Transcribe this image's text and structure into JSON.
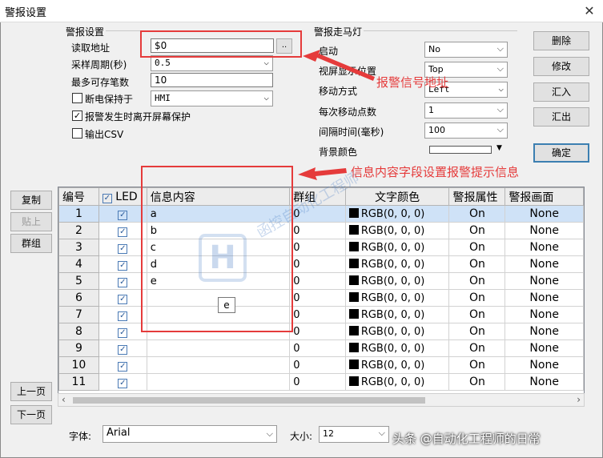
{
  "window": {
    "title": "警报设置",
    "close": "✕"
  },
  "alarm_settings": {
    "group_label": "警报设置",
    "read_address_label": "读取地址",
    "read_address_value": "$0",
    "browse_label": "..",
    "sample_period_label": "采样周期(秒)",
    "sample_period_value": "0.5",
    "max_records_label": "最多可存笔数",
    "max_records_value": "10",
    "power_loss_label": "断电保持于",
    "power_loss_value": "HMI",
    "protect_label": "报警发生时离开屏幕保护",
    "protect_checked": true,
    "csv_label": "输出CSV",
    "csv_checked": false
  },
  "marquee": {
    "group_label": "警报走马灯",
    "enable_label": "启动",
    "enable_value": "No",
    "position_label": "视屏显示位置",
    "position_value": "Top",
    "move_label": "移动方式",
    "move_value": "Left",
    "points_label": "每次移动点数",
    "points_value": "1",
    "interval_label": "间隔时间(毫秒)",
    "interval_value": "100",
    "bg_label": "背景颜色"
  },
  "buttons": {
    "delete": "删除",
    "modify": "修改",
    "import": "汇入",
    "export": "汇出",
    "ok": "确定",
    "copy": "复制",
    "paste": "贴上",
    "group": "群组",
    "prev_page": "上一页",
    "next_page": "下一页"
  },
  "annotations": {
    "address": "报警信号地址",
    "content": "信息内容字段设置报警提示信息"
  },
  "tooltip": "e",
  "table": {
    "headers": {
      "num": "编号",
      "led": "LED",
      "content": "信息内容",
      "group": "群组",
      "color": "文字颜色",
      "attr": "警报属性",
      "screen": "警报画面"
    },
    "rows": [
      {
        "num": "1",
        "content": "a",
        "group": "0",
        "color": "RGB(0, 0, 0)",
        "attr": "On",
        "screen": "None"
      },
      {
        "num": "2",
        "content": "b",
        "group": "0",
        "color": "RGB(0, 0, 0)",
        "attr": "On",
        "screen": "None"
      },
      {
        "num": "3",
        "content": "c",
        "group": "0",
        "color": "RGB(0, 0, 0)",
        "attr": "On",
        "screen": "None"
      },
      {
        "num": "4",
        "content": "d",
        "group": "0",
        "color": "RGB(0, 0, 0)",
        "attr": "On",
        "screen": "None"
      },
      {
        "num": "5",
        "content": "e",
        "group": "0",
        "color": "RGB(0, 0, 0)",
        "attr": "On",
        "screen": "None"
      },
      {
        "num": "6",
        "content": "",
        "group": "0",
        "color": "RGB(0, 0, 0)",
        "attr": "On",
        "screen": "None"
      },
      {
        "num": "7",
        "content": "",
        "group": "0",
        "color": "RGB(0, 0, 0)",
        "attr": "On",
        "screen": "None"
      },
      {
        "num": "8",
        "content": "",
        "group": "0",
        "color": "RGB(0, 0, 0)",
        "attr": "On",
        "screen": "None"
      },
      {
        "num": "9",
        "content": "",
        "group": "0",
        "color": "RGB(0, 0, 0)",
        "attr": "On",
        "screen": "None"
      },
      {
        "num": "10",
        "content": "",
        "group": "0",
        "color": "RGB(0, 0, 0)",
        "attr": "On",
        "screen": "None"
      },
      {
        "num": "11",
        "content": "",
        "group": "0",
        "color": "RGB(0, 0, 0)",
        "attr": "On",
        "screen": "None"
      }
    ]
  },
  "font_row": {
    "font_label": "字体:",
    "font_value": "Arial",
    "size_label": "大小:",
    "size_value": "12"
  },
  "watermark": {
    "logo": "H",
    "text": "函控自动化工程师",
    "credit": "头条 @自动化工程师的日常"
  },
  "colors": {
    "accent": "#e53b3b",
    "selection": "#cfe2f7",
    "default_button": "#3c7fb1"
  }
}
